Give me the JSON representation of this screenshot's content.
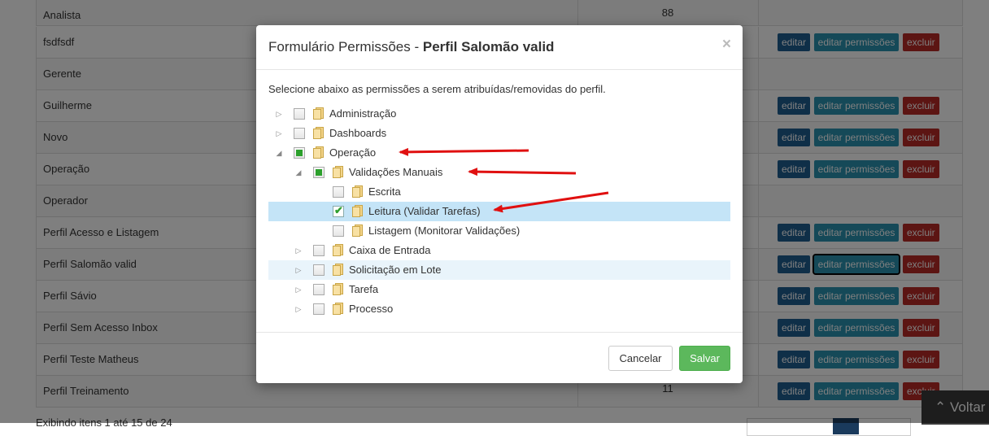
{
  "background": {
    "rows": [
      {
        "name": "Analista",
        "count": "88",
        "actions": false
      },
      {
        "name": "fsdfsdf",
        "count": "",
        "actions": true
      },
      {
        "name": "Gerente",
        "count": "",
        "actions": false
      },
      {
        "name": "Guilherme",
        "count": "",
        "actions": true
      },
      {
        "name": "Novo",
        "count": "",
        "actions": true
      },
      {
        "name": "Operação",
        "count": "",
        "actions": true
      },
      {
        "name": "Operador",
        "count": "",
        "actions": false
      },
      {
        "name": "Perfil Acesso e Listagem",
        "count": "",
        "actions": true
      },
      {
        "name": "Perfil Salomão valid",
        "count": "",
        "actions": true
      },
      {
        "name": "Perfil Sávio",
        "count": "",
        "actions": true
      },
      {
        "name": "Perfil Sem Acesso Inbox",
        "count": "",
        "actions": true
      },
      {
        "name": "Perfil Teste Matheus",
        "count": "",
        "actions": true
      },
      {
        "name": "Perfil Treinamento",
        "count": "11",
        "actions": true
      }
    ],
    "edit_label": "editar",
    "perm_label": "editar permissões",
    "delete_label": "excluir",
    "footer_text": "Exibindo itens 1 até 15 de 24",
    "back_label": "Voltar",
    "back_icon": "chevron-up-icon"
  },
  "modal": {
    "title_prefix": "Formulário Permissões - ",
    "title_profile": "Perfil Salomão valid",
    "close_label": "×",
    "description": "Selecione abaixo as permissões a serem atribuídas/removidas do perfil.",
    "tree": [
      {
        "label": "Administração",
        "level": 0,
        "toggle": "collapsed",
        "check": "none",
        "state": ""
      },
      {
        "label": "Dashboards",
        "level": 0,
        "toggle": "collapsed",
        "check": "none",
        "state": ""
      },
      {
        "label": "Operação",
        "level": 0,
        "toggle": "expanded",
        "check": "partial",
        "state": ""
      },
      {
        "label": "Validações Manuais",
        "level": 1,
        "toggle": "expanded",
        "check": "partial",
        "state": ""
      },
      {
        "label": "Escrita",
        "level": 2,
        "toggle": "none",
        "check": "none",
        "state": ""
      },
      {
        "label": "Leitura (Validar Tarefas)",
        "level": 2,
        "toggle": "none",
        "check": "checked",
        "state": "selected"
      },
      {
        "label": "Listagem (Monitorar Validações)",
        "level": 2,
        "toggle": "none",
        "check": "none",
        "state": ""
      },
      {
        "label": "Caixa de Entrada",
        "level": 1,
        "toggle": "collapsed",
        "check": "none",
        "state": ""
      },
      {
        "label": "Solicitação em Lote",
        "level": 1,
        "toggle": "collapsed",
        "check": "none",
        "state": "hover"
      },
      {
        "label": "Tarefa",
        "level": 1,
        "toggle": "collapsed",
        "check": "none",
        "state": ""
      },
      {
        "label": "Processo",
        "level": 1,
        "toggle": "collapsed",
        "check": "none",
        "state": ""
      }
    ],
    "cancel_label": "Cancelar",
    "save_label": "Salvar"
  },
  "colors": {
    "edit": "#1f5e91",
    "permissions": "#2b92b0",
    "delete": "#b82a26",
    "save": "#5cb85c",
    "selected_row": "#c4e4f7",
    "annotation_arrow": "#e01010"
  }
}
